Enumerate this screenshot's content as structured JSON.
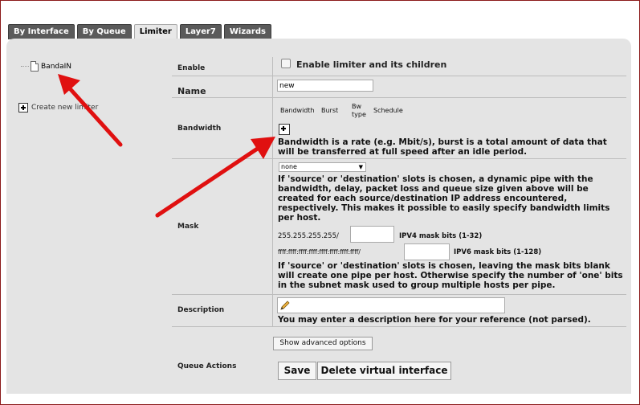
{
  "tabs": [
    {
      "label": "By Interface",
      "active": false
    },
    {
      "label": "By Queue",
      "active": false
    },
    {
      "label": "Limiter",
      "active": true
    },
    {
      "label": "Layer7",
      "active": false
    },
    {
      "label": "Wizards",
      "active": false
    }
  ],
  "tree": {
    "item_label": "BandaIN"
  },
  "sidebar": {
    "create_label": "Create new limiter"
  },
  "form": {
    "enable": {
      "label": "Enable",
      "checkbox_label": "Enable limiter and its children",
      "checked": false
    },
    "name": {
      "label": "Name",
      "value": "new"
    },
    "bandwidth": {
      "label": "Bandwidth",
      "columns": [
        "Bandwidth",
        "Burst",
        "Bw type",
        "Schedule"
      ],
      "col_bwtype_line1": "Bw",
      "col_bwtype_line2": "type",
      "help_line1": "Bandwidth is a rate (e.g. Mbit/s), burst is a total amount of data that",
      "help_line2": "will be transferred at full speed after an idle period."
    },
    "mask": {
      "label": "Mask",
      "select_value": "none",
      "help1_line1": "If 'source' or 'destination' slots is chosen, a dynamic pipe with the",
      "help1_line2": "bandwidth, delay, packet loss and queue size given above will be",
      "help1_line3": "created for each source/destination IP address encountered,",
      "help1_line4": "respectively. This makes it possible to easily specify bandwidth limits",
      "help1_line5": "per host.",
      "ipv4_prefix": "255.255.255.255/",
      "ipv4_label": "IPV4 mask bits (1-32)",
      "ipv6_prefix": "ffff:ffff:ffff:ffff:ffff:ffff:ffff:ffff/",
      "ipv6_label": "IPV6 mask bits (1-128)",
      "help2_line1": "If 'source' or 'destination' slots is chosen, leaving the mask bits blank",
      "help2_line2": "will create one pipe per host. Otherwise specify the number of 'one' bits",
      "help2_line3": "in the subnet mask used to group multiple hosts per pipe."
    },
    "description": {
      "label": "Description",
      "help": "You may enter a description here for your reference (not parsed)."
    },
    "advanced_button": "Show advanced options",
    "queue_actions": {
      "label": "Queue Actions",
      "save": "Save",
      "delete": "Delete virtual interface"
    }
  },
  "colors": {
    "annotation_arrow": "#e01010",
    "tab_bg": "#5a5a5a",
    "panel_bg": "#e4e4e4",
    "frame": "#8b1a1a"
  }
}
